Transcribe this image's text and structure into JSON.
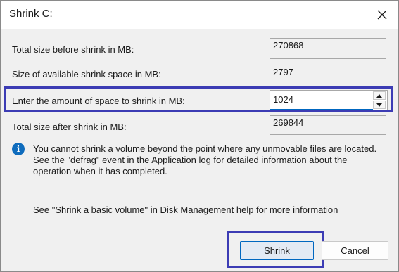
{
  "window": {
    "title": "Shrink C:"
  },
  "fields": {
    "total_before": {
      "label": "Total size before shrink in MB:",
      "value": "270868"
    },
    "available": {
      "label": "Size of available shrink space in MB:",
      "value": "2797"
    },
    "amount": {
      "label": "Enter the amount of space to shrink in MB:",
      "value": "1024"
    },
    "total_after": {
      "label": "Total size after shrink in MB:",
      "value": "269844"
    }
  },
  "info": {
    "icon": "info-icon",
    "lines": [
      "You cannot shrink a volume beyond the point where any unmovable files are located.",
      "See the \"defrag\" event in the Application log for detailed information about the",
      "operation when it has completed."
    ],
    "help": "See \"Shrink a basic volume\" in Disk Management help for more information"
  },
  "buttons": {
    "shrink": "Shrink",
    "cancel": "Cancel"
  },
  "colors": {
    "highlight": "#3c3cb4",
    "accent": "#0067c0",
    "info": "#0f6cbd"
  }
}
